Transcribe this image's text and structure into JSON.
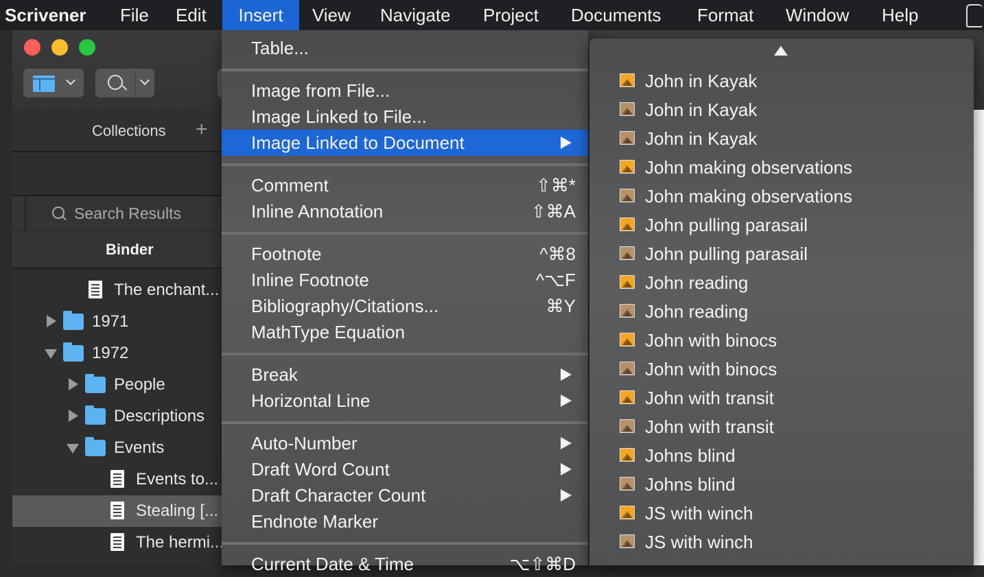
{
  "menubar": {
    "app": "Scrivener",
    "items": [
      "File",
      "Edit",
      "Insert",
      "View",
      "Navigate",
      "Project",
      "Documents",
      "Format",
      "Window",
      "Help"
    ],
    "active": "Insert"
  },
  "sidebar": {
    "collections_label": "Collections",
    "add_symbol": "+",
    "search_results_label": "Search Results",
    "binder_label": "Binder",
    "tree": [
      {
        "label": "The enchant...",
        "type": "doc",
        "depth": 2,
        "expanded": null
      },
      {
        "label": "1971",
        "type": "folder",
        "depth": 1,
        "expanded": false
      },
      {
        "label": "1972",
        "type": "folder",
        "depth": 1,
        "expanded": true
      },
      {
        "label": "People",
        "type": "folder",
        "depth": 2,
        "expanded": false
      },
      {
        "label": "Descriptions",
        "type": "folder",
        "depth": 2,
        "expanded": false
      },
      {
        "label": "Events",
        "type": "folder",
        "depth": 2,
        "expanded": true
      },
      {
        "label": "Events to...",
        "type": "doc",
        "depth": 3,
        "expanded": null
      },
      {
        "label": "Stealing [...",
        "type": "doc",
        "depth": 3,
        "expanded": null,
        "selected": true
      },
      {
        "label": "The hermi...",
        "type": "doc",
        "depth": 3,
        "expanded": null
      }
    ]
  },
  "insert_menu": {
    "items": [
      {
        "label": "Table...",
        "shortcut": "",
        "submenu": false
      },
      {
        "label": "Image from File...",
        "shortcut": "",
        "submenu": false
      },
      {
        "label": "Image Linked to File...",
        "shortcut": "",
        "submenu": false
      },
      {
        "label": "Image Linked to Document",
        "shortcut": "",
        "submenu": true,
        "highlighted": true
      },
      {
        "label": "Comment",
        "shortcut": "⇧⌘*",
        "submenu": false
      },
      {
        "label": "Inline Annotation",
        "shortcut": "⇧⌘A",
        "submenu": false
      },
      {
        "label": "Footnote",
        "shortcut": "^⌘8",
        "submenu": false
      },
      {
        "label": "Inline Footnote",
        "shortcut": "^⌥F",
        "submenu": false
      },
      {
        "label": "Bibliography/Citations...",
        "shortcut": "⌘Y",
        "submenu": false
      },
      {
        "label": "MathType Equation",
        "shortcut": "",
        "submenu": false
      },
      {
        "label": "Break",
        "shortcut": "",
        "submenu": true
      },
      {
        "label": "Horizontal Line",
        "shortcut": "",
        "submenu": true
      },
      {
        "label": "Auto-Number",
        "shortcut": "",
        "submenu": true
      },
      {
        "label": "Draft Word Count",
        "shortcut": "",
        "submenu": true
      },
      {
        "label": "Draft Character Count",
        "shortcut": "",
        "submenu": true
      },
      {
        "label": "Endnote Marker",
        "shortcut": "",
        "submenu": false
      },
      {
        "label": "Current Date & Time",
        "shortcut": "⌥⇧⌘D",
        "submenu": false
      }
    ]
  },
  "submenu": {
    "items": [
      {
        "label": "John in Kayak",
        "icon": "image-icon",
        "icon_color": "#f5a623"
      },
      {
        "label": "John in Kayak",
        "icon": "image-icon",
        "icon_color": "#b8916a"
      },
      {
        "label": "John in Kayak",
        "icon": "image-icon",
        "icon_color": "#b8916a"
      },
      {
        "label": "John making observations",
        "icon": "image-icon",
        "icon_color": "#f5a623"
      },
      {
        "label": "John making observations",
        "icon": "image-icon",
        "icon_color": "#b8916a"
      },
      {
        "label": "John pulling parasail",
        "icon": "image-icon",
        "icon_color": "#f5a623"
      },
      {
        "label": "John pulling parasail",
        "icon": "image-icon",
        "icon_color": "#b8916a"
      },
      {
        "label": "John reading",
        "icon": "image-icon",
        "icon_color": "#f5a623"
      },
      {
        "label": "John reading",
        "icon": "image-icon",
        "icon_color": "#b8916a"
      },
      {
        "label": "John with binocs",
        "icon": "image-icon",
        "icon_color": "#f5a623"
      },
      {
        "label": "John with binocs",
        "icon": "image-icon",
        "icon_color": "#b8916a"
      },
      {
        "label": "John with transit",
        "icon": "image-icon",
        "icon_color": "#f5a623"
      },
      {
        "label": "John with transit",
        "icon": "image-icon",
        "icon_color": "#b8916a"
      },
      {
        "label": "Johns blind",
        "icon": "image-icon",
        "icon_color": "#f5a623"
      },
      {
        "label": "Johns blind",
        "icon": "image-icon",
        "icon_color": "#b8916a"
      },
      {
        "label": "JS with winch",
        "icon": "image-icon",
        "icon_color": "#f5a623"
      },
      {
        "label": "JS with winch",
        "icon": "image-icon",
        "icon_color": "#b8916a"
      }
    ]
  },
  "colors": {
    "accent": "#1d67d6",
    "folder": "#5cb3f2",
    "close": "#fc5f57",
    "minimize": "#fdbc2e",
    "zoom": "#28c840"
  }
}
